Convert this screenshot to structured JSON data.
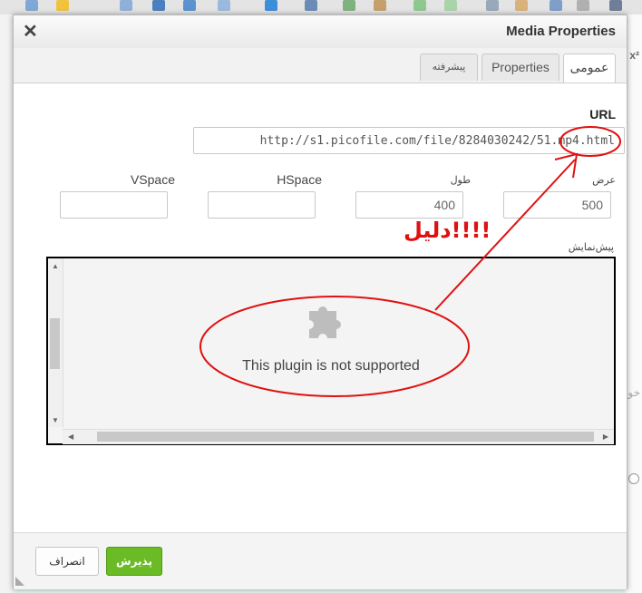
{
  "dialog": {
    "title": "Media Properties",
    "close_glyph": "✕"
  },
  "tabs": [
    {
      "label": "عمومی",
      "active": true
    },
    {
      "label": "Properties",
      "active": false
    },
    {
      "label": "پیشرفته",
      "active": false
    }
  ],
  "form": {
    "url_label": "URL",
    "url_value": "http://s1.picofile.com/file/8284030242/51.mp4.html",
    "width_label": "عرض",
    "width_value": "500",
    "height_label": "طول",
    "height_value": "400",
    "hspace_label": "HSpace",
    "hspace_value": "",
    "vspace_label": "VSpace",
    "vspace_value": "",
    "preview_label": "پیش‌نمایش",
    "plugin_message": "This plugin is not supported"
  },
  "footer": {
    "ok_label": "پذیرش",
    "cancel_label": "انصراف"
  },
  "annotation": {
    "text": "دلیل!!!!",
    "color": "#e01010"
  },
  "colors": {
    "accent_green": "#6bbb26",
    "annotation_red": "#e01010"
  },
  "icons": [
    "close-icon",
    "puzzle-piece-icon",
    "scroll-up-icon",
    "scroll-down-icon",
    "scroll-left-icon",
    "scroll-right-icon",
    "resize-grip-icon"
  ]
}
